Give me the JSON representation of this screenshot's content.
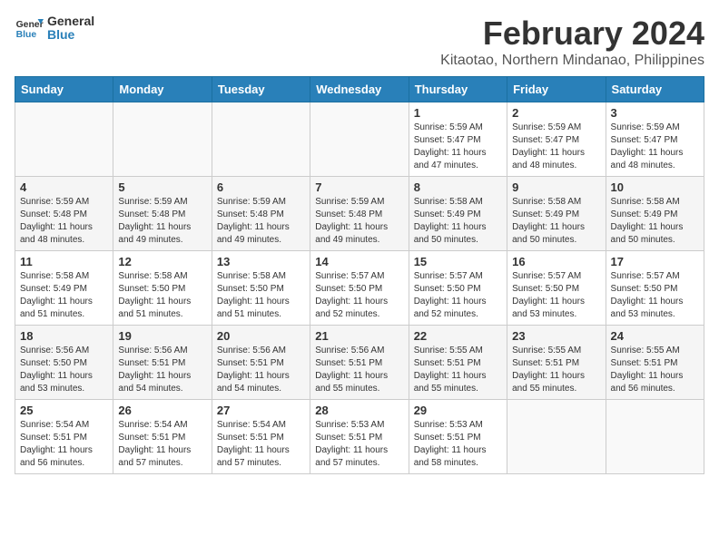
{
  "logo": {
    "line1": "General",
    "line2": "Blue"
  },
  "title": "February 2024",
  "subtitle": "Kitaotao, Northern Mindanao, Philippines",
  "days_of_week": [
    "Sunday",
    "Monday",
    "Tuesday",
    "Wednesday",
    "Thursday",
    "Friday",
    "Saturday"
  ],
  "weeks": [
    [
      {
        "day": "",
        "info": ""
      },
      {
        "day": "",
        "info": ""
      },
      {
        "day": "",
        "info": ""
      },
      {
        "day": "",
        "info": ""
      },
      {
        "day": "1",
        "info": "Sunrise: 5:59 AM\nSunset: 5:47 PM\nDaylight: 11 hours\nand 47 minutes."
      },
      {
        "day": "2",
        "info": "Sunrise: 5:59 AM\nSunset: 5:47 PM\nDaylight: 11 hours\nand 48 minutes."
      },
      {
        "day": "3",
        "info": "Sunrise: 5:59 AM\nSunset: 5:47 PM\nDaylight: 11 hours\nand 48 minutes."
      }
    ],
    [
      {
        "day": "4",
        "info": "Sunrise: 5:59 AM\nSunset: 5:48 PM\nDaylight: 11 hours\nand 48 minutes."
      },
      {
        "day": "5",
        "info": "Sunrise: 5:59 AM\nSunset: 5:48 PM\nDaylight: 11 hours\nand 49 minutes."
      },
      {
        "day": "6",
        "info": "Sunrise: 5:59 AM\nSunset: 5:48 PM\nDaylight: 11 hours\nand 49 minutes."
      },
      {
        "day": "7",
        "info": "Sunrise: 5:59 AM\nSunset: 5:48 PM\nDaylight: 11 hours\nand 49 minutes."
      },
      {
        "day": "8",
        "info": "Sunrise: 5:58 AM\nSunset: 5:49 PM\nDaylight: 11 hours\nand 50 minutes."
      },
      {
        "day": "9",
        "info": "Sunrise: 5:58 AM\nSunset: 5:49 PM\nDaylight: 11 hours\nand 50 minutes."
      },
      {
        "day": "10",
        "info": "Sunrise: 5:58 AM\nSunset: 5:49 PM\nDaylight: 11 hours\nand 50 minutes."
      }
    ],
    [
      {
        "day": "11",
        "info": "Sunrise: 5:58 AM\nSunset: 5:49 PM\nDaylight: 11 hours\nand 51 minutes."
      },
      {
        "day": "12",
        "info": "Sunrise: 5:58 AM\nSunset: 5:50 PM\nDaylight: 11 hours\nand 51 minutes."
      },
      {
        "day": "13",
        "info": "Sunrise: 5:58 AM\nSunset: 5:50 PM\nDaylight: 11 hours\nand 51 minutes."
      },
      {
        "day": "14",
        "info": "Sunrise: 5:57 AM\nSunset: 5:50 PM\nDaylight: 11 hours\nand 52 minutes."
      },
      {
        "day": "15",
        "info": "Sunrise: 5:57 AM\nSunset: 5:50 PM\nDaylight: 11 hours\nand 52 minutes."
      },
      {
        "day": "16",
        "info": "Sunrise: 5:57 AM\nSunset: 5:50 PM\nDaylight: 11 hours\nand 53 minutes."
      },
      {
        "day": "17",
        "info": "Sunrise: 5:57 AM\nSunset: 5:50 PM\nDaylight: 11 hours\nand 53 minutes."
      }
    ],
    [
      {
        "day": "18",
        "info": "Sunrise: 5:56 AM\nSunset: 5:50 PM\nDaylight: 11 hours\nand 53 minutes."
      },
      {
        "day": "19",
        "info": "Sunrise: 5:56 AM\nSunset: 5:51 PM\nDaylight: 11 hours\nand 54 minutes."
      },
      {
        "day": "20",
        "info": "Sunrise: 5:56 AM\nSunset: 5:51 PM\nDaylight: 11 hours\nand 54 minutes."
      },
      {
        "day": "21",
        "info": "Sunrise: 5:56 AM\nSunset: 5:51 PM\nDaylight: 11 hours\nand 55 minutes."
      },
      {
        "day": "22",
        "info": "Sunrise: 5:55 AM\nSunset: 5:51 PM\nDaylight: 11 hours\nand 55 minutes."
      },
      {
        "day": "23",
        "info": "Sunrise: 5:55 AM\nSunset: 5:51 PM\nDaylight: 11 hours\nand 55 minutes."
      },
      {
        "day": "24",
        "info": "Sunrise: 5:55 AM\nSunset: 5:51 PM\nDaylight: 11 hours\nand 56 minutes."
      }
    ],
    [
      {
        "day": "25",
        "info": "Sunrise: 5:54 AM\nSunset: 5:51 PM\nDaylight: 11 hours\nand 56 minutes."
      },
      {
        "day": "26",
        "info": "Sunrise: 5:54 AM\nSunset: 5:51 PM\nDaylight: 11 hours\nand 57 minutes."
      },
      {
        "day": "27",
        "info": "Sunrise: 5:54 AM\nSunset: 5:51 PM\nDaylight: 11 hours\nand 57 minutes."
      },
      {
        "day": "28",
        "info": "Sunrise: 5:53 AM\nSunset: 5:51 PM\nDaylight: 11 hours\nand 57 minutes."
      },
      {
        "day": "29",
        "info": "Sunrise: 5:53 AM\nSunset: 5:51 PM\nDaylight: 11 hours\nand 58 minutes."
      },
      {
        "day": "",
        "info": ""
      },
      {
        "day": "",
        "info": ""
      }
    ]
  ]
}
